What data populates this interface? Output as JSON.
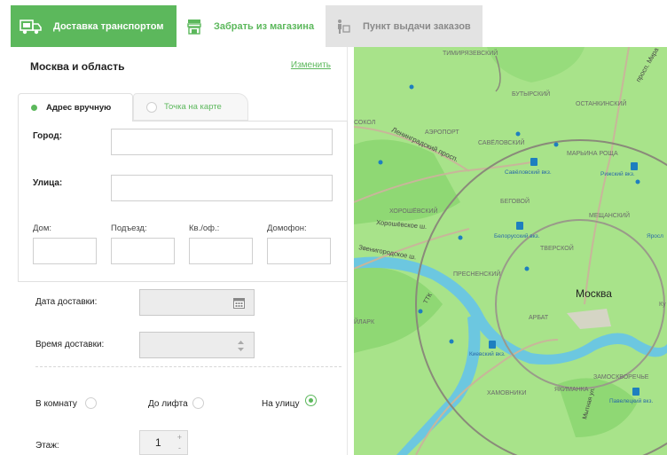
{
  "tabs": {
    "delivery": "Доставка транспортом",
    "pickup": "Забрать из магазина",
    "pickpoint": "Пункт выдачи заказов"
  },
  "region": {
    "name": "Москва и область",
    "change": "Изменить"
  },
  "address_tabs": {
    "manual": "Адрес вручную",
    "map": "Точка на карте"
  },
  "form": {
    "city_label": "Город:",
    "street_label": "Улица:",
    "house_label": "Дом:",
    "entrance_label": "Подъезд:",
    "apt_label": "Кв./оф.:",
    "intercom_label": "Домофон:"
  },
  "delivery": {
    "date_label": "Дата доставки:",
    "time_label": "Время доставки:",
    "options": [
      "В комнату",
      "До лифта",
      "На улицу"
    ],
    "selected_option": "На улицу",
    "floor_label": "Этаж:",
    "floor_value": "1"
  },
  "map": {
    "city": "Москва",
    "labels": [
      "ТИМИРЯЗЕВСКИЙ",
      "БУТЫРСКИЙ",
      "ОСТАНКИНСКИЙ",
      "СОКОЛ",
      "АЭРОПОРТ",
      "САВЁЛОВСКИЙ",
      "МАРЬИНА РОЩА",
      "Ленинградский просп.",
      "Савёловский вкз.",
      "Рижский вкз.",
      "БЕГОВОЙ",
      "ХОРОШЁВСКИЙ",
      "МЕЩАНСКИЙ",
      "Хорошёвское ш.",
      "Белорусский вкз.",
      "Яросл",
      "ТВЕРСКОЙ",
      "Звенигородское ш.",
      "ПРЕСНЕНСКИЙ",
      "ТТК",
      "ЙЛАРК",
      "АРБАТ",
      "Киевский вкз.",
      "ЗАМОСКВОРЕЧЬЕ",
      "ХАМОВНИКИ",
      "ЯКИМАНКА",
      "Павелецкий вкз.",
      "просп. Мира",
      "Мытная ул.",
      "Ку"
    ]
  },
  "colors": {
    "accent": "#5cb85c",
    "map_green": "#a8e38a"
  }
}
